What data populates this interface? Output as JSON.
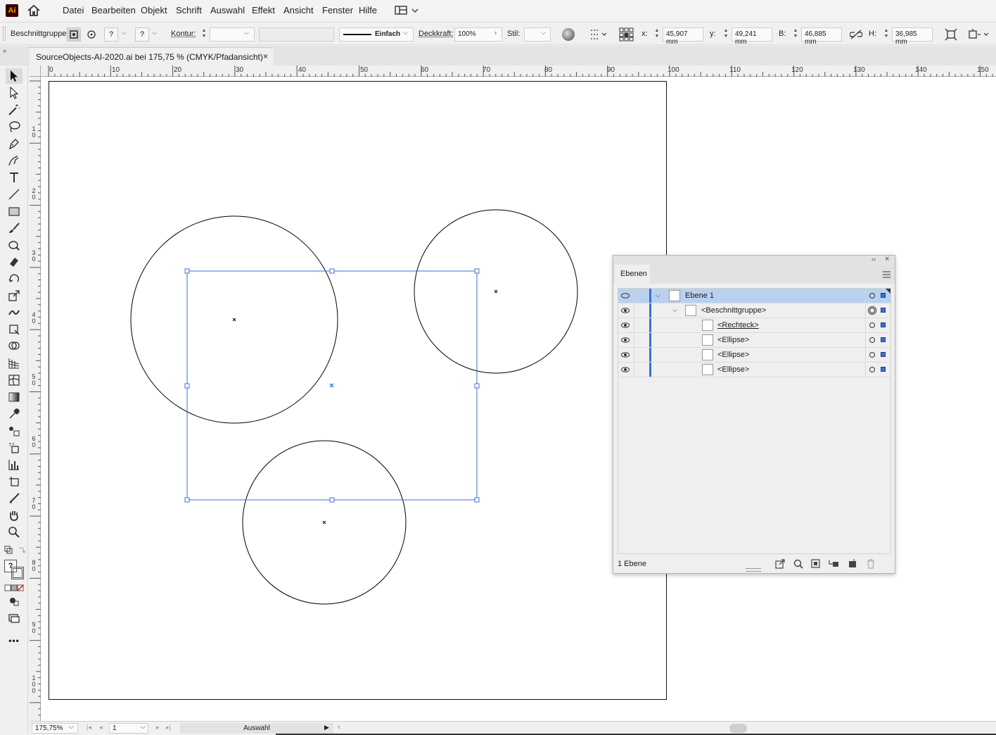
{
  "app": {
    "logo_text": "Ai"
  },
  "menu": [
    "Datei",
    "Bearbeiten",
    "Objekt",
    "Schrift",
    "Auswahl",
    "Effekt",
    "Ansicht",
    "Fenster",
    "Hilfe"
  ],
  "control": {
    "object_type": "Beschnittgruppe",
    "question_a": "?",
    "question_b": "?",
    "stroke_label": "Kontur:",
    "stroke_value": "",
    "stroke_style": "Einfach",
    "opacity_label": "Deckkraft:",
    "opacity_value": "100%",
    "style_label": "Stil:",
    "x_label": "x:",
    "x_value": "45,907 mm",
    "y_label": "y:",
    "y_value": "49,241 mm",
    "w_label": "B:",
    "w_value": "46,885 mm",
    "h_label": "H:",
    "h_value": "36,985 mm"
  },
  "document_tab": {
    "title": "SourceObjects-AI-2020.ai bei 175,75 % (CMYK/Pfadansicht)",
    "close": "×"
  },
  "ruler_top": [
    "0",
    "10",
    "20",
    "30",
    "40",
    "50",
    "60",
    "70",
    "80",
    "90",
    "100",
    "110",
    "120",
    "130",
    "140",
    "150"
  ],
  "ruler_left": [
    [
      "1",
      "0"
    ],
    [
      "2",
      "0"
    ],
    [
      "3",
      "0"
    ],
    [
      "4",
      "0"
    ],
    [
      "5",
      "0"
    ],
    [
      "6",
      "0"
    ],
    [
      "7",
      "0"
    ],
    [
      "8",
      "0"
    ],
    [
      "9",
      "0"
    ],
    [
      "1",
      "0",
      "0"
    ]
  ],
  "status": {
    "zoom": "175,75%",
    "artboard": "1",
    "tool": "Auswahl"
  },
  "layers_panel": {
    "tab": "Ebenen",
    "rows": [
      {
        "name": "Ebene 1",
        "selected": true
      },
      {
        "name": "<Beschnittgruppe>",
        "selected": false
      },
      {
        "name": "<Rechteck>",
        "selected": false
      },
      {
        "name": "<Ellipse>",
        "selected": false
      },
      {
        "name": "<Ellipse>",
        "selected": false
      },
      {
        "name": "<Ellipse>",
        "selected": false
      }
    ],
    "count": "1 Ebene"
  },
  "colors": {
    "selection": "#3b6fd6",
    "layer_selected_bg": "#b9d1ef",
    "artwork_stroke": "#000000"
  }
}
